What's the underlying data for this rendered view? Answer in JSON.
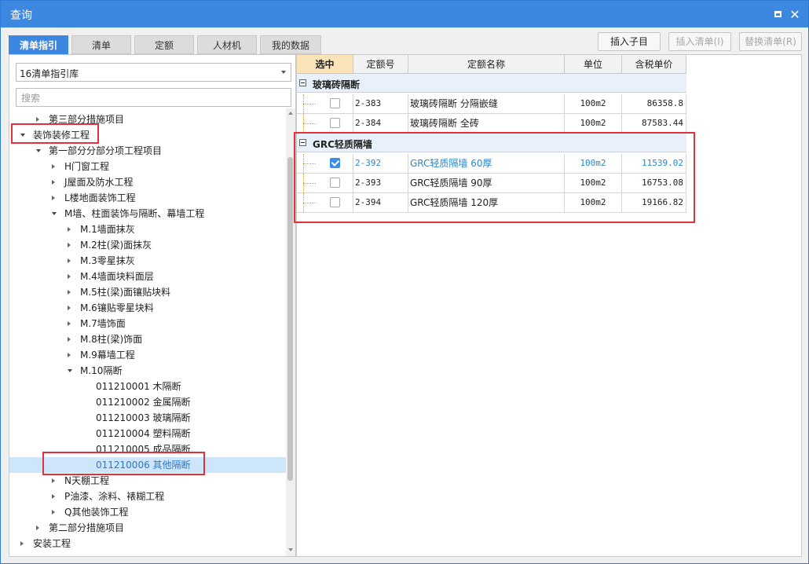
{
  "window": {
    "title": "查询"
  },
  "tabs": [
    "清单指引",
    "清单",
    "定额",
    "人材机",
    "我的数据"
  ],
  "toolbar": {
    "insert_child": "插入子目",
    "insert_list": "插入清单(I)",
    "replace_list": "替换清单(R)"
  },
  "library": {
    "selected": "16清单指引库"
  },
  "search": {
    "placeholder": "搜索"
  },
  "tree": [
    {
      "label": "第三部分措施项目",
      "level": 1,
      "state": "collapsed"
    },
    {
      "label": "装饰装修工程",
      "level": 0,
      "state": "expanded"
    },
    {
      "label": "第一部分分部分项工程项目",
      "level": 1,
      "state": "expanded"
    },
    {
      "label": "H门窗工程",
      "level": 2,
      "state": "collapsed"
    },
    {
      "label": "J屋面及防水工程",
      "level": 2,
      "state": "collapsed"
    },
    {
      "label": "L楼地面装饰工程",
      "level": 2,
      "state": "collapsed"
    },
    {
      "label": "M墙、柱面装饰与隔断、幕墙工程",
      "level": 2,
      "state": "expanded"
    },
    {
      "label": "M.1墙面抹灰",
      "level": 3,
      "state": "collapsed"
    },
    {
      "label": "M.2柱(梁)面抹灰",
      "level": 3,
      "state": "collapsed"
    },
    {
      "label": "M.3零星抹灰",
      "level": 3,
      "state": "collapsed"
    },
    {
      "label": "M.4墙面块料面层",
      "level": 3,
      "state": "collapsed"
    },
    {
      "label": "M.5柱(梁)面镶贴块料",
      "level": 3,
      "state": "collapsed"
    },
    {
      "label": "M.6镶贴零星块料",
      "level": 3,
      "state": "collapsed"
    },
    {
      "label": "M.7墙饰面",
      "level": 3,
      "state": "collapsed"
    },
    {
      "label": "M.8柱(梁)饰面",
      "level": 3,
      "state": "collapsed"
    },
    {
      "label": "M.9幕墙工程",
      "level": 3,
      "state": "collapsed"
    },
    {
      "label": "M.10隔断",
      "level": 3,
      "state": "expanded"
    },
    {
      "label": "011210001  木隔断",
      "level": 4,
      "state": "leaf"
    },
    {
      "label": "011210002  金属隔断",
      "level": 4,
      "state": "leaf"
    },
    {
      "label": "011210003  玻璃隔断",
      "level": 4,
      "state": "leaf"
    },
    {
      "label": "011210004  塑料隔断",
      "level": 4,
      "state": "leaf"
    },
    {
      "label": "011210005  成品隔断",
      "level": 4,
      "state": "leaf"
    },
    {
      "label": "011210006  其他隔断",
      "level": 4,
      "state": "leaf",
      "selected": true
    },
    {
      "label": "N天棚工程",
      "level": 2,
      "state": "collapsed"
    },
    {
      "label": "P油漆、涂料、裱糊工程",
      "level": 2,
      "state": "collapsed"
    },
    {
      "label": "Q其他装饰工程",
      "level": 2,
      "state": "collapsed"
    },
    {
      "label": "第二部分措施项目",
      "level": 1,
      "state": "collapsed"
    },
    {
      "label": "安装工程",
      "level": 0,
      "state": "collapsed"
    }
  ],
  "grid": {
    "columns": [
      "选中",
      "定额号",
      "定额名称",
      "单位",
      "含税单价"
    ],
    "groups": [
      {
        "name": "玻璃砖隔断",
        "rows": [
          {
            "checked": false,
            "code": "2-383",
            "name": "玻璃砖隔断 分隔嵌缝",
            "unit": "100m2",
            "price": "86358.8"
          },
          {
            "checked": false,
            "code": "2-384",
            "name": "玻璃砖隔断 全砖",
            "unit": "100m2",
            "price": "87583.44"
          }
        ]
      },
      {
        "name": "GRC轻质隔墙",
        "rows": [
          {
            "checked": true,
            "code": "2-392",
            "name": "GRC轻质隔墙 60厚",
            "unit": "100m2",
            "price": "11539.02"
          },
          {
            "checked": false,
            "code": "2-393",
            "name": "GRC轻质隔墙 90厚",
            "unit": "100m2",
            "price": "16753.08"
          },
          {
            "checked": false,
            "code": "2-394",
            "name": "GRC轻质隔墙 120厚",
            "unit": "100m2",
            "price": "19166.82"
          }
        ]
      }
    ]
  }
}
